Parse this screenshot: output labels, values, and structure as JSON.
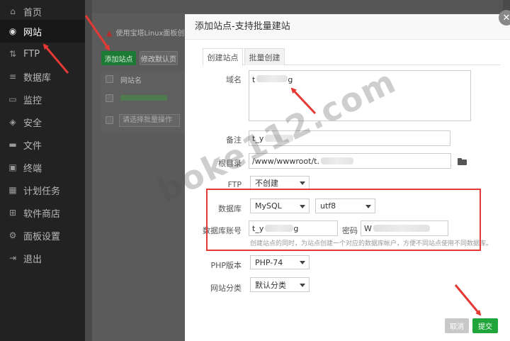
{
  "sidebar": {
    "items": [
      {
        "label": "首页",
        "icon": "home-icon"
      },
      {
        "label": "网站",
        "icon": "globe-icon",
        "active": true
      },
      {
        "label": "FTP",
        "icon": "ftp-icon"
      },
      {
        "label": "数据库",
        "icon": "database-icon"
      },
      {
        "label": "监控",
        "icon": "monitor-icon"
      },
      {
        "label": "安全",
        "icon": "shield-icon"
      },
      {
        "label": "文件",
        "icon": "folder-icon"
      },
      {
        "label": "终端",
        "icon": "terminal-icon"
      },
      {
        "label": "计划任务",
        "icon": "calendar-icon"
      },
      {
        "label": "软件商店",
        "icon": "store-icon"
      },
      {
        "label": "面板设置",
        "icon": "gear-icon"
      },
      {
        "label": "退出",
        "icon": "logout-icon"
      }
    ]
  },
  "background": {
    "warning": "使用宝塔Linux面板创建站",
    "add_site_button": "添加站点",
    "modify_default_button": "修改默认页",
    "table_header_site": "网站名",
    "bulk_select_placeholder": "请选择批量操作"
  },
  "dialog": {
    "title": "添加站点-支持批量建站",
    "close_icon": "close-icon",
    "tabs": [
      "创建站点",
      "批量创建"
    ],
    "domain": {
      "label": "域名",
      "value_prefix": "t",
      "value_suffix": "g"
    },
    "remark": {
      "label": "备注",
      "value_prefix": "t_y"
    },
    "root_dir": {
      "label": "根目录",
      "value": "/www/wwwroot/t."
    },
    "ftp": {
      "label": "FTP",
      "selected": "不创建"
    },
    "database": {
      "label": "数据库",
      "type": "MySQL",
      "charset": "utf8"
    },
    "db_account": {
      "label": "数据库账号",
      "value_prefix": "t_y",
      "value_suffix": "g"
    },
    "db_password": {
      "label": "密码",
      "value_prefix": "W"
    },
    "db_hint": "创建站点的同时，为站点创建一个对应的数据库帐户，方便不同站点使用不同数据库。",
    "php_version": {
      "label": "PHP版本",
      "selected": "PHP-74"
    },
    "site_category": {
      "label": "网站分类",
      "selected": "默认分类"
    },
    "cancel_button": "取消",
    "submit_button": "提交"
  },
  "watermark": "boke112.com",
  "colors": {
    "accent_green": "#20a53a",
    "annotation_red": "#e53935"
  }
}
